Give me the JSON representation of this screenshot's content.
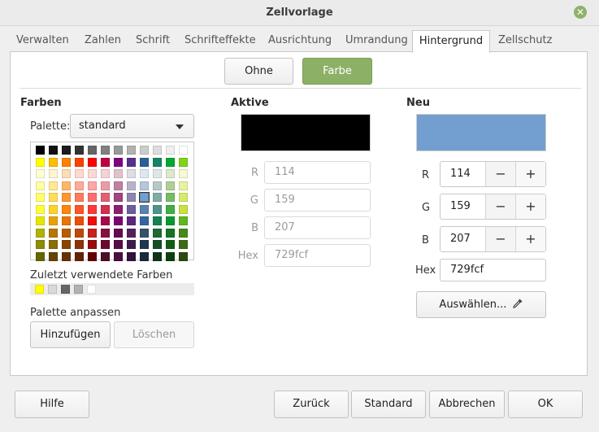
{
  "window": {
    "title": "Zellvorlage"
  },
  "tabs": [
    "Verwalten",
    "Zahlen",
    "Schrift",
    "Schrifteffekte",
    "Ausrichtung",
    "Umrandung",
    "Hintergrund",
    "Zellschutz"
  ],
  "active_tab": "Hintergrund",
  "mode_buttons": {
    "none": "Ohne",
    "color": "Farbe"
  },
  "colors_section": {
    "heading": "Farben",
    "palette_label": "Palette:",
    "palette_value": "standard",
    "recent_label": "Zuletzt verwendete Farben",
    "recent_colors": [
      "#ffff00",
      "#d9d9d9",
      "#666666",
      "#b2b2b2",
      "#ffffff"
    ],
    "customize_label": "Palette anpassen",
    "add_button": "Hinzufügen",
    "delete_button": "Löschen"
  },
  "palette_rows": [
    [
      "#000000",
      "#111111",
      "#1c1c1c",
      "#333333",
      "#666666",
      "#808080",
      "#999999",
      "#b2b2b2",
      "#cccccc",
      "#dddddd",
      "#eeeeee",
      "#ffffff"
    ],
    [
      "#ffff00",
      "#ffbf00",
      "#ff8000",
      "#ff4000",
      "#ff0000",
      "#bf0041",
      "#800080",
      "#55308d",
      "#2a6099",
      "#158466",
      "#00a933",
      "#81d41a"
    ],
    [
      "#ffffd7",
      "#fff5ce",
      "#ffdbb6",
      "#ffd8ce",
      "#ffd7d7",
      "#f7d1d5",
      "#e0c2cd",
      "#dedce6",
      "#dee6ef",
      "#dee7e5",
      "#dde8cb",
      "#f6f9d4"
    ],
    [
      "#ffffa6",
      "#ffe994",
      "#ffb66c",
      "#ffaa95",
      "#ffa6a6",
      "#ec9ba4",
      "#bf819e",
      "#b7b3ca",
      "#b4c7dc",
      "#b3cac7",
      "#afd095",
      "#e8f2a1"
    ],
    [
      "#ffff6d",
      "#ffde59",
      "#ff972f",
      "#ff7b59",
      "#ff6d6d",
      "#e16173",
      "#a1467e",
      "#8e86ae",
      "#729fcf",
      "#81aca6",
      "#77bc65",
      "#d4ea6b"
    ],
    [
      "#ffff38",
      "#ffd428",
      "#ff860d",
      "#ff5429",
      "#ff3838",
      "#d62e4e",
      "#8d1d75",
      "#6b5e9b",
      "#5983b0",
      "#50938a",
      "#3faf46",
      "#c9e143"
    ],
    [
      "#e6e600",
      "#e8a202",
      "#ea7500",
      "#ed4c05",
      "#f10d0c",
      "#a7074b",
      "#780373",
      "#5b277d",
      "#3465a4",
      "#168253",
      "#069a2e",
      "#5eb91e"
    ],
    [
      "#b2b200",
      "#b47804",
      "#b85c00",
      "#be480a",
      "#c9211e",
      "#861141",
      "#650953",
      "#55215b",
      "#355269",
      "#1e6a39",
      "#127622",
      "#468a1a"
    ],
    [
      "#8d8d00",
      "#8c6d02",
      "#8a4500",
      "#90310a",
      "#9b0b0b",
      "#6b0a2d",
      "#590a48",
      "#3f1b4c",
      "#1f3651",
      "#144e28",
      "#125d14",
      "#3e6b14"
    ],
    [
      "#666600",
      "#664400",
      "#663300",
      "#662200",
      "#660000",
      "#4d0f24",
      "#4d0d40",
      "#33123d",
      "#1a2a3d",
      "#0f3318",
      "#0c4010",
      "#2b4a0d"
    ]
  ],
  "active": {
    "heading": "Aktive",
    "swatch": "#000000",
    "r_label": "R",
    "r": "114",
    "g_label": "G",
    "g": "159",
    "b_label": "B",
    "b": "207",
    "hex_label": "Hex",
    "hex": "729fcf"
  },
  "new": {
    "heading": "Neu",
    "swatch": "#729fcf",
    "r_label": "R",
    "r": "114",
    "g_label": "G",
    "g": "159",
    "b_label": "B",
    "b": "207",
    "hex_label": "Hex",
    "hex": "729fcf",
    "pick_button": "Auswählen..."
  },
  "footer": {
    "help": "Hilfe",
    "reset": "Zurück",
    "standard": "Standard",
    "cancel": "Abbrechen",
    "ok": "OK"
  },
  "colors": {
    "accent": "#8cb066",
    "palette_selected": "#729fcf"
  }
}
